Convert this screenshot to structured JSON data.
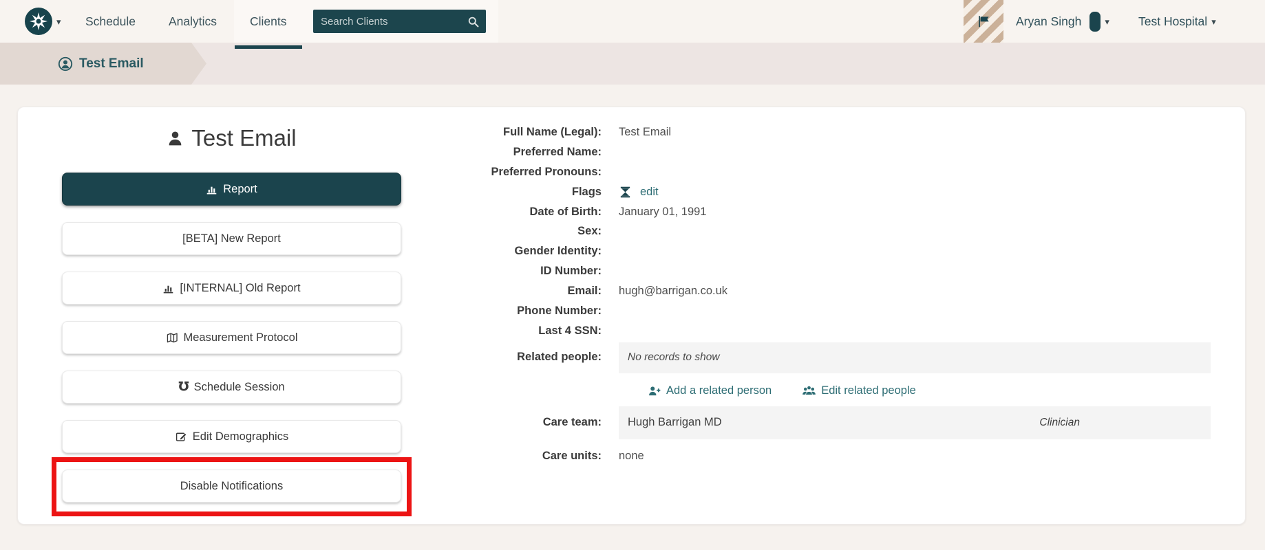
{
  "colors": {
    "accent_teal": "#1b444d",
    "link_teal": "#2d6d74",
    "annotation_red": "#ec1414",
    "header_bg": "#f8f4f0",
    "breadcrumb_bg": "#ede5e3",
    "breadcrumb_chip": "#e2d8d2",
    "row_gray": "#f4f4f4",
    "badge_stripe": "#cbb199"
  },
  "icons": {
    "logo": "eight-point-star-icon",
    "logo_caret": "▾",
    "search": "magnifier-icon",
    "flag": "flag-icon",
    "user_device": "phone-pill-icon",
    "user_caret": "▾",
    "org_caret": "▾",
    "breadcrumb_person": "person-circle-icon",
    "client_person": "person-bust-icon",
    "report": "bar-chart-icon",
    "measurement": "map-icon",
    "schedule_session": "℧",
    "edit_demographics": "pencil-square-icon",
    "flags_status": "hourglass-icon",
    "add_person": "person-plus-icon",
    "edit_people": "people-icon"
  },
  "header": {
    "nav": [
      {
        "label": "Schedule"
      },
      {
        "label": "Analytics"
      },
      {
        "label": "Clients",
        "active": true
      }
    ],
    "search": {
      "placeholder": "Search Clients"
    },
    "user": {
      "name": "Aryan Singh"
    },
    "org": {
      "name": "Test Hospital"
    }
  },
  "breadcrumb": {
    "label": "Test Email"
  },
  "client": {
    "title": "Test Email"
  },
  "sidebar": {
    "buttons": [
      {
        "label": "Report",
        "style": "primary",
        "icon": "bar-chart"
      },
      {
        "label": "[BETA] New Report"
      },
      {
        "label": "[INTERNAL] Old Report",
        "icon": "bar-chart"
      },
      {
        "label": "Measurement Protocol",
        "icon": "map"
      },
      {
        "label": "Schedule Session",
        "icon": "stethoscope"
      },
      {
        "label": "Edit Demographics",
        "icon": "pencil-square"
      },
      {
        "label": "Disable Notifications",
        "annotated": "red-box"
      }
    ]
  },
  "details": {
    "rows": [
      {
        "label": "Full Name (Legal):",
        "value": "Test Email"
      },
      {
        "label": "Preferred Name:",
        "value": ""
      },
      {
        "label": "Preferred Pronouns:",
        "value": ""
      },
      {
        "label": "Flags",
        "value": "edit"
      },
      {
        "label": "Date of Birth:",
        "value": "January 01, 1991"
      },
      {
        "label": "Sex:",
        "value": ""
      },
      {
        "label": "Gender Identity:",
        "value": ""
      },
      {
        "label": "ID Number:",
        "value": ""
      },
      {
        "label": "Email:",
        "value": "hugh@barrigan.co.uk"
      },
      {
        "label": "Phone Number:",
        "value": ""
      },
      {
        "label": "Last 4 SSN:",
        "value": ""
      }
    ],
    "related_people": {
      "label": "Related people:",
      "empty_text": "No records to show",
      "add_link": "Add a related person",
      "edit_link": "Edit related people"
    },
    "care_team": {
      "label": "Care team:",
      "member": "Hugh Barrigan MD",
      "role": "Clinician"
    },
    "care_units": {
      "label": "Care units:",
      "value": "none"
    }
  }
}
